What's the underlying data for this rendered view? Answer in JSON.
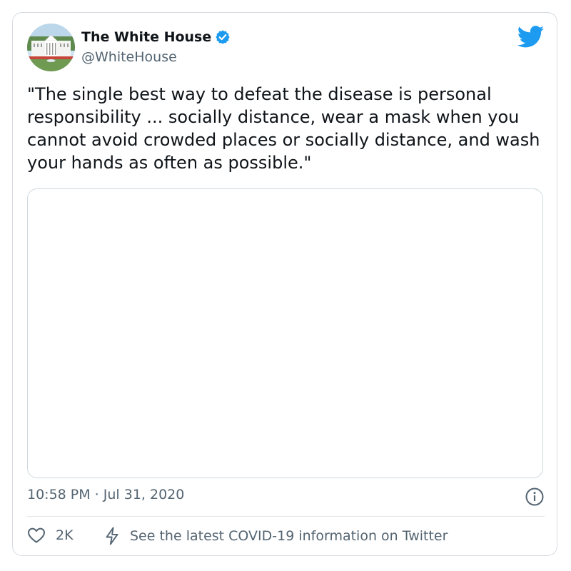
{
  "tweet": {
    "author_name": "The White House",
    "handle": "@WhiteHouse",
    "text": "\"The single best way to defeat the disease is personal responsibility ... socially distance, wear a mask when you cannot avoid crowded places or socially distance, and wash your hands as often as possible.\"",
    "timestamp": "10:58 PM · Jul 31, 2020",
    "like_count": "2K",
    "covid_link_text": "See the latest COVID-19 information on Twitter"
  },
  "icons": {
    "verified": "verified-badge-icon",
    "brand": "twitter-bird-icon",
    "info": "info-icon",
    "like": "heart-icon",
    "covid": "lightning-bolt-icon"
  },
  "colors": {
    "brand_blue": "#1d9bf0",
    "text_primary": "#0f1419",
    "text_secondary": "#536471",
    "border": "#cfd9de"
  }
}
